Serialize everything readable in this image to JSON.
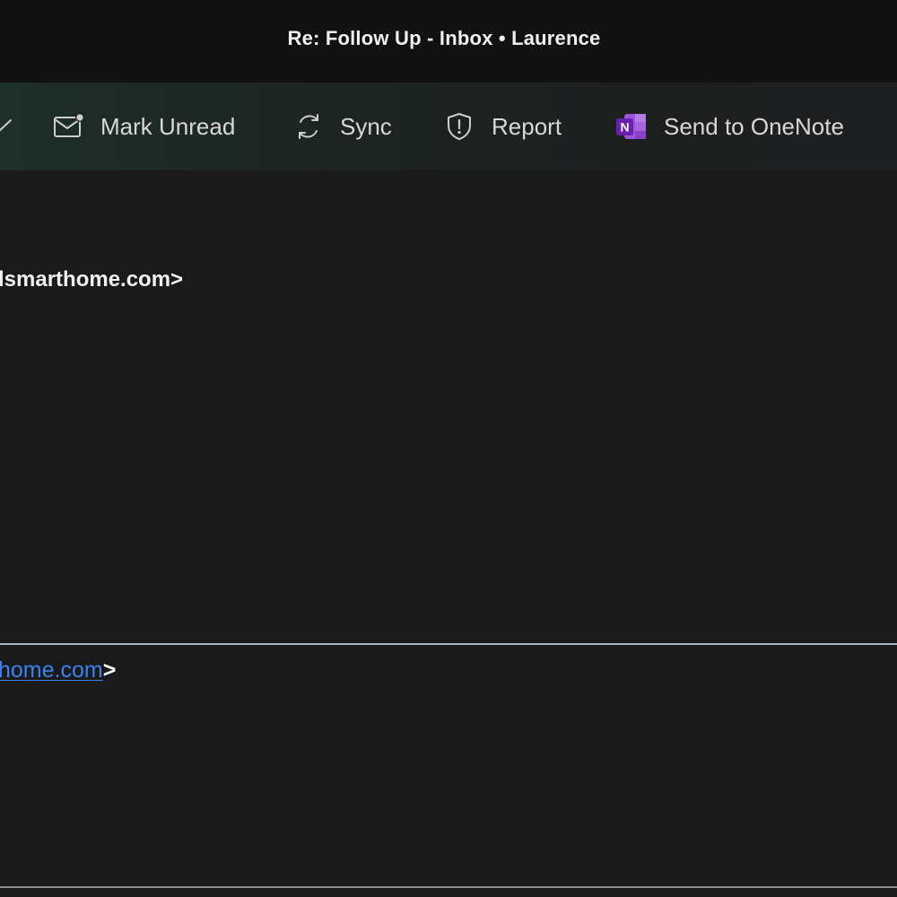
{
  "window": {
    "title": "Re: Follow Up - Inbox • Laurence"
  },
  "toolbar": {
    "items": [
      {
        "label": "",
        "icon": "check-icon"
      },
      {
        "label": "Mark Unread",
        "icon": "envelope-unread-icon"
      },
      {
        "label": "Sync",
        "icon": "sync-icon"
      },
      {
        "label": "Report",
        "icon": "shield-alert-icon"
      },
      {
        "label": "Send to OneNote",
        "icon": "onenote-icon"
      }
    ]
  },
  "message": {
    "sender_fragment": "lsmarthome.com>",
    "quoted_link_fragment": "home.com",
    "quoted_bracket": ">"
  },
  "colors": {
    "link": "#3b82f0",
    "onenote_purple": "#7b2fbf",
    "background": "#1a1a1a"
  }
}
